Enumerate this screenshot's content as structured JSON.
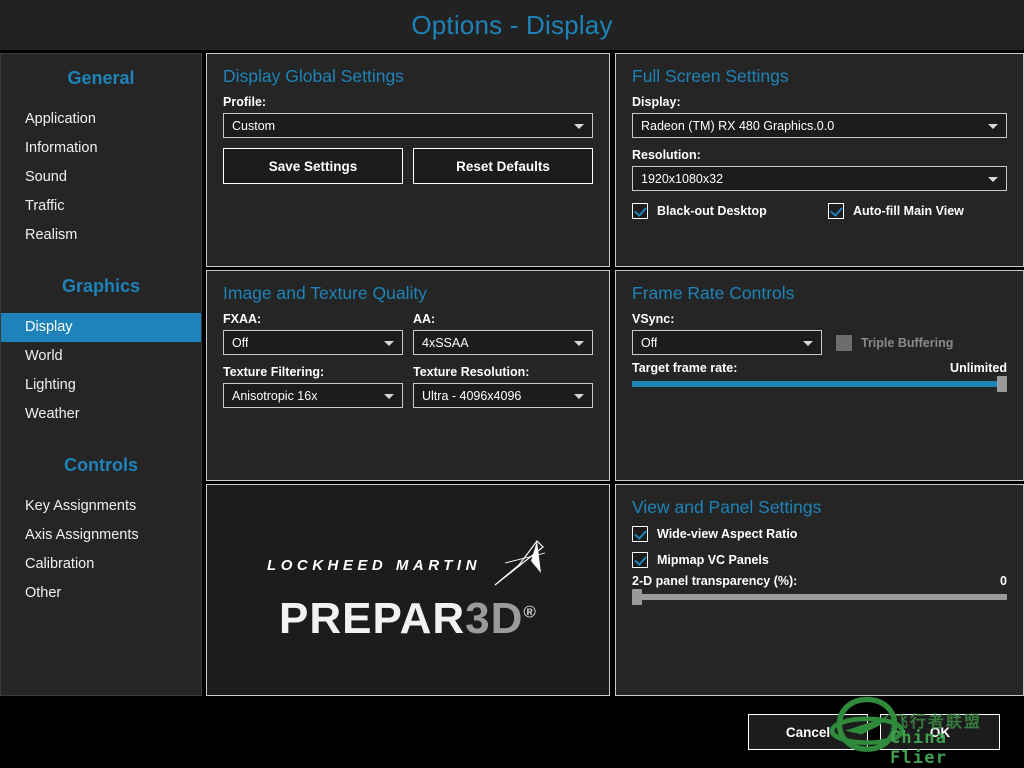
{
  "window": {
    "title": "Options - Display"
  },
  "theme": {
    "accent": "#1d83b8",
    "panel_bg": "#252525",
    "page_bg": "#000000",
    "text": "#ffffff",
    "border": "#c9c9c9",
    "slider_track": "#9a9a9a",
    "watermark_green": "#3fa150"
  },
  "sidebar": {
    "groups": [
      {
        "title": "General",
        "items": [
          {
            "label": "Application",
            "active": false
          },
          {
            "label": "Information",
            "active": false
          },
          {
            "label": "Sound",
            "active": false
          },
          {
            "label": "Traffic",
            "active": false
          },
          {
            "label": "Realism",
            "active": false
          }
        ]
      },
      {
        "title": "Graphics",
        "items": [
          {
            "label": "Display",
            "active": true
          },
          {
            "label": "World",
            "active": false
          },
          {
            "label": "Lighting",
            "active": false
          },
          {
            "label": "Weather",
            "active": false
          }
        ]
      },
      {
        "title": "Controls",
        "items": [
          {
            "label": "Key Assignments",
            "active": false
          },
          {
            "label": "Axis Assignments",
            "active": false
          },
          {
            "label": "Calibration",
            "active": false
          },
          {
            "label": "Other",
            "active": false
          }
        ]
      }
    ]
  },
  "display_global_settings": {
    "title": "Display Global Settings",
    "profile_label": "Profile:",
    "profile_value": "Custom",
    "save_button": "Save Settings",
    "reset_button": "Reset Defaults"
  },
  "full_screen_settings": {
    "title": "Full Screen Settings",
    "display_label": "Display:",
    "display_value": "Radeon (TM) RX 480 Graphics.0.0",
    "resolution_label": "Resolution:",
    "resolution_value": "1920x1080x32",
    "blackout_desktop_label": "Black-out Desktop",
    "blackout_desktop_checked": true,
    "autofill_main_view_label": "Auto-fill Main View",
    "autofill_main_view_checked": true
  },
  "image_and_texture_quality": {
    "title": "Image and Texture Quality",
    "fxaa_label": "FXAA:",
    "fxaa_value": "Off",
    "aa_label": "AA:",
    "aa_value": "4xSSAA",
    "texture_filtering_label": "Texture Filtering:",
    "texture_filtering_value": "Anisotropic 16x",
    "texture_resolution_label": "Texture Resolution:",
    "texture_resolution_value": "Ultra - 4096x4096"
  },
  "frame_rate_controls": {
    "title": "Frame Rate Controls",
    "vsync_label": "VSync:",
    "vsync_value": "Off",
    "triple_buffering_label": "Triple Buffering",
    "triple_buffering_checked": false,
    "triple_buffering_disabled": true,
    "target_frame_rate_label": "Target frame rate:",
    "target_frame_rate_value": "Unlimited",
    "target_frame_rate_percent": 100
  },
  "view_and_panel_settings": {
    "title": "View and Panel Settings",
    "wide_view_label": "Wide-view Aspect Ratio",
    "wide_view_checked": true,
    "mipmap_label": "Mipmap VC Panels",
    "mipmap_checked": true,
    "transparency_label": "2-D panel transparency (%):",
    "transparency_value": "0",
    "transparency_percent": 0
  },
  "branding": {
    "company": "LOCKHEED MARTIN",
    "product_light": "PREPAR",
    "product_dark": "3D",
    "registered_mark": "®"
  },
  "footer": {
    "cancel_label": "Cancel",
    "ok_label": "OK"
  },
  "watermark": {
    "chinese": "飞行者联盟",
    "english": "China Flier"
  }
}
